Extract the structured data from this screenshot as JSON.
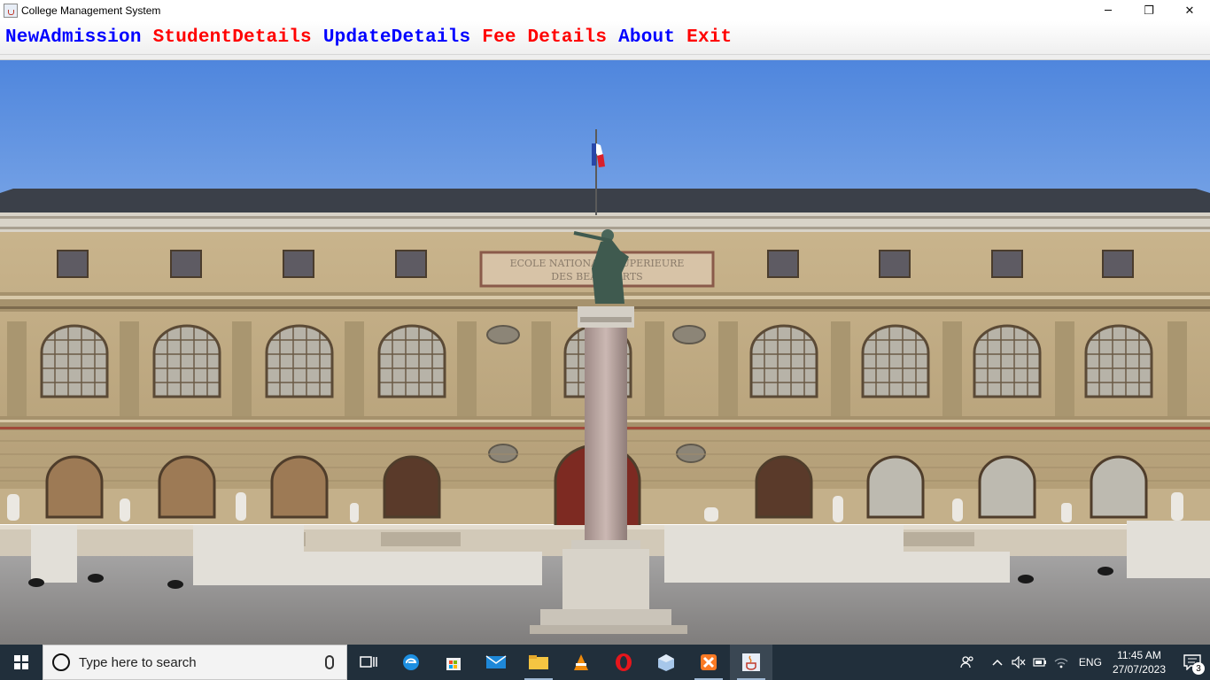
{
  "window": {
    "title": "College Management System",
    "minimize_glyph": "─",
    "maximize_glyph": "❐",
    "close_glyph": "✕"
  },
  "menu": {
    "items": [
      {
        "label": "NewAdmission",
        "color": "#0000ff"
      },
      {
        "label": "StudentDetails",
        "color": "#ff0000"
      },
      {
        "label": "UpdateDetails",
        "color": "#0000ff"
      },
      {
        "label": "Fee Details",
        "color": "#ff0000"
      },
      {
        "label": "About",
        "color": "#0000ff"
      },
      {
        "label": "Exit",
        "color": "#ff0000"
      }
    ]
  },
  "background_image": {
    "facade_inscription_line1": "ECOLE NATIONALE SUPERIEURE",
    "facade_inscription_line2": "DES BEAUX ARTS"
  },
  "taskbar": {
    "search_placeholder": "Type here to search",
    "apps": [
      "task-view-icon",
      "edge-icon",
      "store-icon",
      "mail-icon",
      "file-explorer-icon",
      "vlc-icon",
      "opera-icon",
      "virtualbox-icon",
      "xampp-icon",
      "java-icon"
    ],
    "tray": {
      "language": "ENG",
      "time": "11:45 AM",
      "date": "27/07/2023",
      "notification_count": "3"
    }
  }
}
